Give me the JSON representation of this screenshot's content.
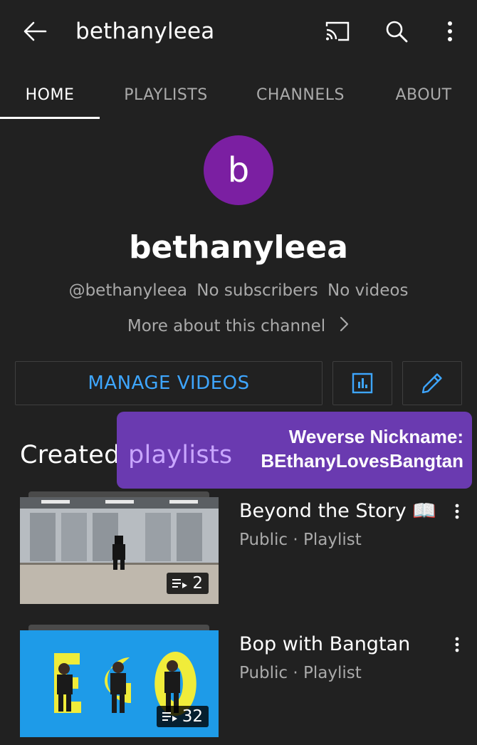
{
  "header": {
    "title": "bethanyleea",
    "icons": [
      "back-arrow-icon",
      "cast-icon",
      "search-icon",
      "more-vert-icon"
    ]
  },
  "tabs": [
    {
      "label": "HOME",
      "active": true
    },
    {
      "label": "PLAYLISTS",
      "active": false
    },
    {
      "label": "CHANNELS",
      "active": false
    },
    {
      "label": "ABOUT",
      "active": false
    }
  ],
  "channel": {
    "avatar_letter": "b",
    "avatar_color": "#7b1fa2",
    "name": "bethanyleea",
    "handle": "@bethanyleea",
    "subscribers": "No subscribers",
    "videos": "No videos",
    "more_about": "More about this channel"
  },
  "actions": {
    "manage_label": "MANAGE VIDEOS",
    "accent_color": "#3ea6ff"
  },
  "section": {
    "title": "Created playlists",
    "title_left": "Created ",
    "title_right": "playlists"
  },
  "overlay": {
    "line1": "Weverse Nickname:",
    "line2": "BEthanyLovesBangtan",
    "background": "#6a3ab0"
  },
  "playlists": [
    {
      "title": "Beyond the Story 📖",
      "subtitle": "Public · Playlist",
      "count": "2"
    },
    {
      "title": "Bop with Bangtan",
      "subtitle": "Public · Playlist",
      "count": "32"
    }
  ]
}
